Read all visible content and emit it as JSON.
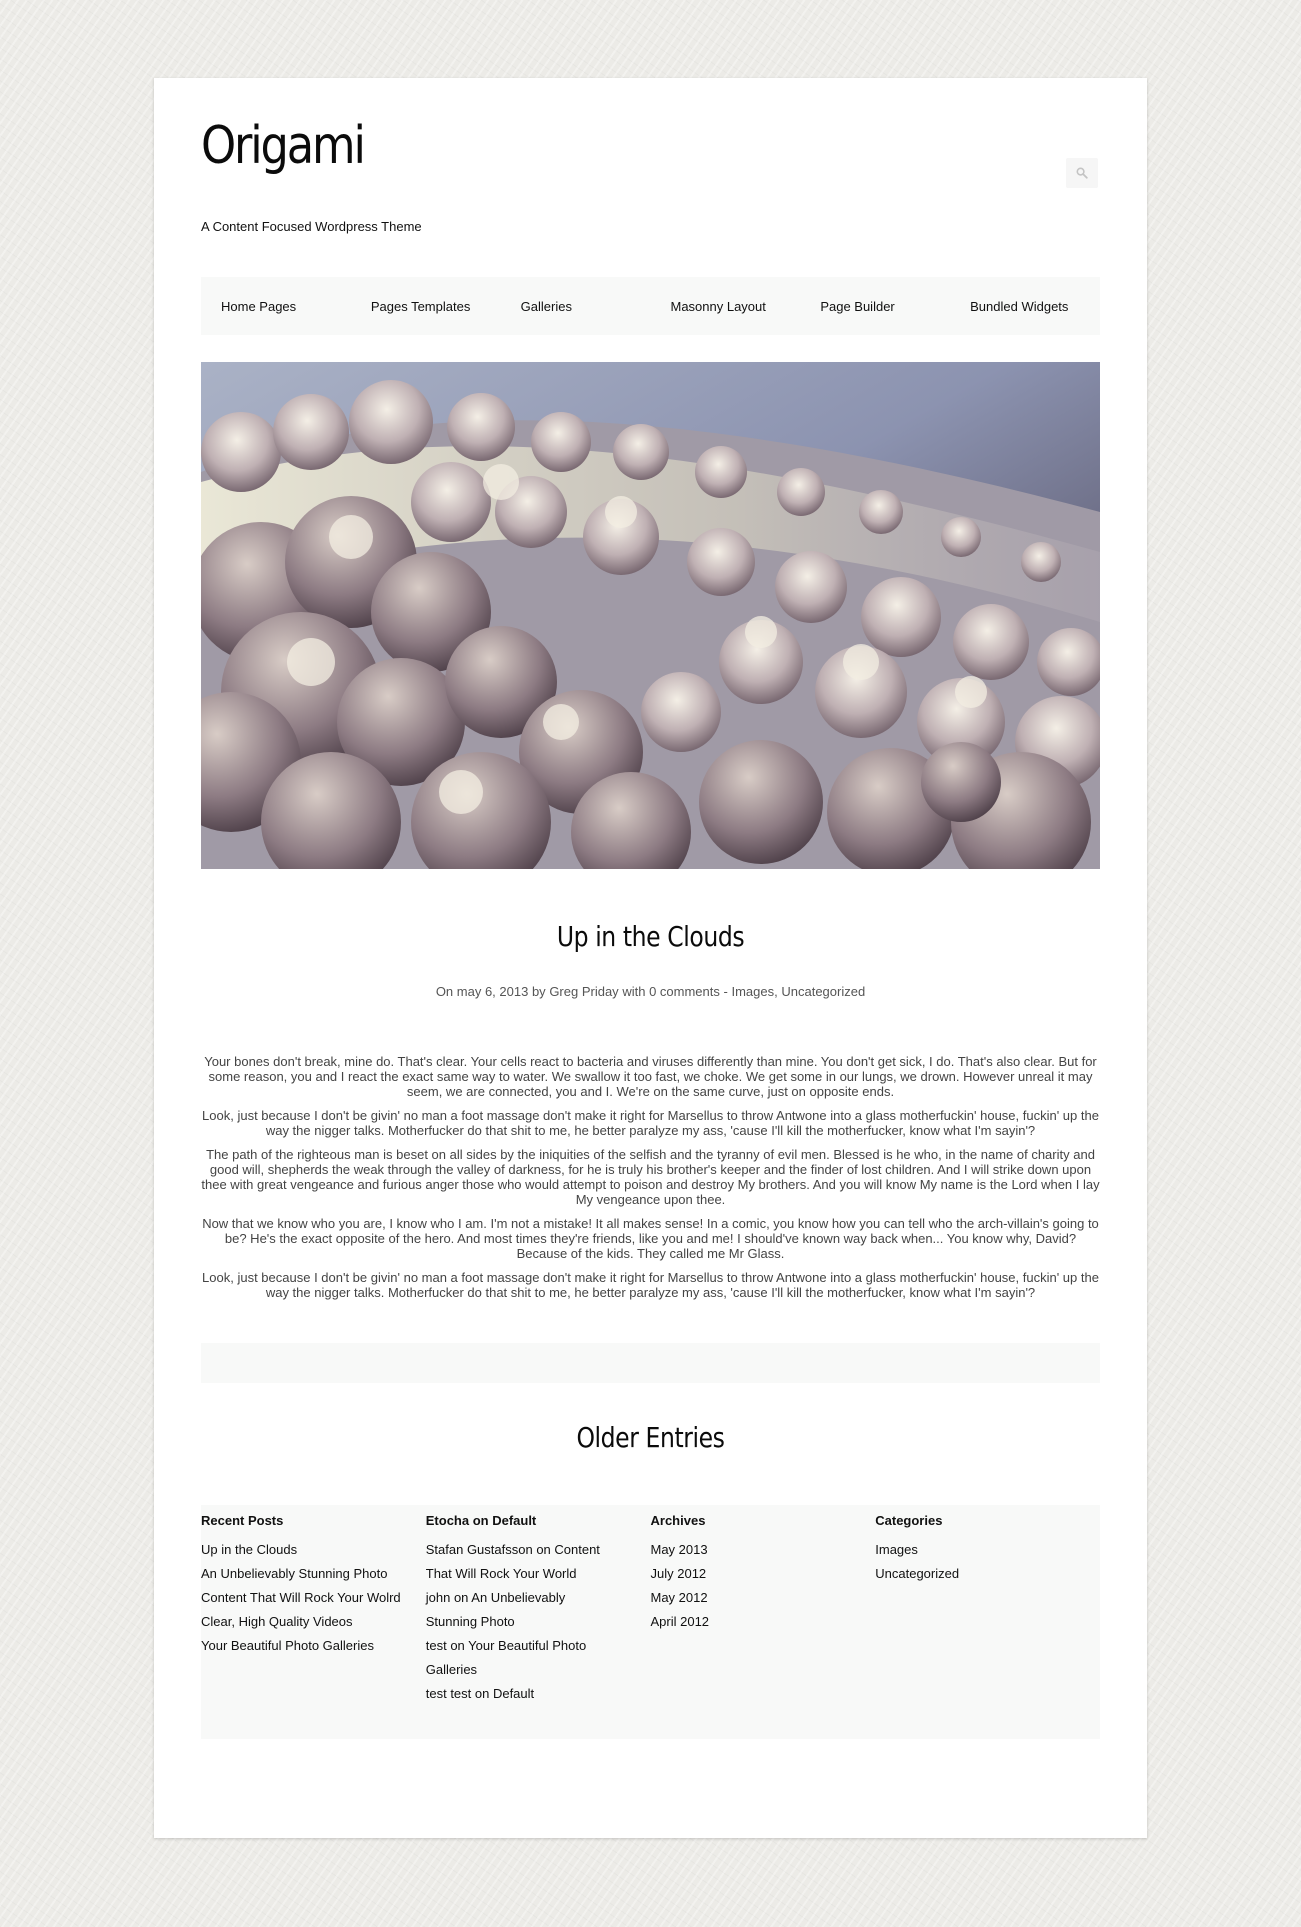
{
  "site": {
    "title": "Origami",
    "tagline": "A Content Focused Wordpress Theme"
  },
  "search": {
    "icon": "search-icon"
  },
  "nav": {
    "items": [
      {
        "label": "Home Pages"
      },
      {
        "label": "Pages Templates"
      },
      {
        "label": "Galleries"
      },
      {
        "label": "Masonny Layout"
      },
      {
        "label": "Page Builder"
      },
      {
        "label": "Bundled Widgets"
      }
    ]
  },
  "post": {
    "title": "Up in the Clouds",
    "meta": {
      "prefix": "On",
      "date": "may 6, 2013",
      "by": "by",
      "author": "Greg Priday",
      "with": "with",
      "comments": "0 comments",
      "dash": "-",
      "category1": "Images",
      "comma": ",",
      "category2": "Uncategorized"
    },
    "paragraphs": [
      "Your bones don't break, mine do. That's clear. Your cells react to bacteria and viruses differently than mine. You don't get sick, I do. That's also clear. But for some reason, you and I react the exact same way to water. We swallow it too fast, we choke. We get some in our lungs, we drown. However unreal it may seem, we are connected, you and I. We're on the same curve, just on opposite ends.",
      "Look, just because I don't be givin' no man a foot massage don't make it right for Marsellus to throw Antwone into a glass motherfuckin' house, fuckin' up the way the nigger talks. Motherfucker do that shit to me, he better paralyze my ass, 'cause I'll kill the motherfucker, know what I'm sayin'?",
      "The path of the righteous man is beset on all sides by the iniquities of the selfish and the tyranny of evil men. Blessed is he who, in the name of charity and good will, shepherds the weak through the valley of darkness, for he is truly his brother's keeper and the finder of lost children. And I will strike down upon thee with great vengeance and furious anger those who would attempt to poison and destroy My brothers. And you will know My name is the Lord when I lay My vengeance upon thee.",
      "Now that we know who you are, I know who I am. I'm not a mistake! It all makes sense! In a comic, you know how you can tell who the arch-villain's going to be? He's the exact opposite of the hero. And most times they're friends, like you and me! I should've known way back when... You know why, David? Because of the kids. They called me Mr Glass.",
      "Look, just because I don't be givin' no man a foot massage don't make it right for Marsellus to throw Antwone into a glass motherfuckin' house, fuckin' up the way the nigger talks. Motherfucker do that shit to me, he better paralyze my ass, 'cause I'll kill the motherfucker, know what I'm sayin'?"
    ]
  },
  "older_entries": "Older Entries",
  "widgets": {
    "recent_posts": {
      "title": "Recent Posts",
      "items": [
        "Up in the Clouds",
        "An Unbelievably Stunning Photo",
        "Content That Will Rock Your Wolrd",
        "Clear, High Quality Videos",
        "Your Beautiful Photo Galleries"
      ]
    },
    "recent_comments": {
      "title": "Etocha on Default",
      "lines": [
        "Stafan Gustafsson on Content",
        "That Will Rock Your World",
        "john on An Unbelievably",
        "Stunning Photo",
        "test on Your Beautiful Photo",
        "Galleries",
        "test test on Default"
      ]
    },
    "archives": {
      "title": "Archives",
      "items": [
        "May 2013",
        "July 2012",
        "May 2012",
        "April 2012"
      ]
    },
    "categories": {
      "title": "Categories",
      "items": [
        "Images",
        "Uncategorized"
      ]
    }
  }
}
